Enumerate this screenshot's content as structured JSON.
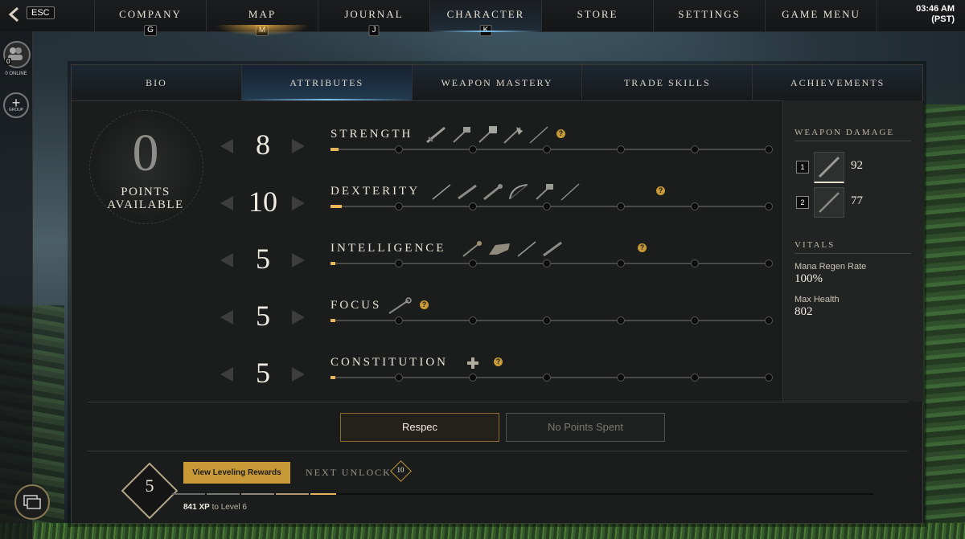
{
  "topbar": {
    "esc_label": "ESC",
    "nav": [
      {
        "label": "COMPANY",
        "key": "G"
      },
      {
        "label": "MAP",
        "key": "M"
      },
      {
        "label": "JOURNAL",
        "key": "J"
      },
      {
        "label": "CHARACTER",
        "key": "K"
      },
      {
        "label": "STORE",
        "key": ""
      },
      {
        "label": "SETTINGS",
        "key": ""
      },
      {
        "label": "GAME MENU",
        "key": ""
      }
    ],
    "time": "03:46 AM",
    "timezone": "(PST)"
  },
  "rail": {
    "online_count": "0",
    "online_label": "0 ONLINE",
    "group_label": "GROUP"
  },
  "tabs": [
    "BIO",
    "ATTRIBUTES",
    "WEAPON MASTERY",
    "TRADE SKILLS",
    "ACHIEVEMENTS"
  ],
  "points": {
    "value": "0",
    "label_line1": "POINTS",
    "label_line2": "AVAILABLE"
  },
  "attributes": [
    {
      "name": "STRENGTH",
      "value": "8",
      "weapon_icons": [
        "sword-icon",
        "hatchet-icon",
        "war-hammer-icon",
        "great-axe-icon",
        "spear-icon"
      ]
    },
    {
      "name": "DEXTERITY",
      "value": "10",
      "weapon_icons": [
        "rapier-icon",
        "musket-icon",
        "blunderbuss-icon",
        "bow-icon",
        "hatchet-icon",
        "spear-icon"
      ]
    },
    {
      "name": "INTELLIGENCE",
      "value": "5",
      "weapon_icons": [
        "fire-staff-icon",
        "void-gauntlet-icon",
        "rapier-icon",
        "musket-icon"
      ]
    },
    {
      "name": "FOCUS",
      "value": "5",
      "weapon_icons": [
        "life-staff-icon"
      ]
    },
    {
      "name": "CONSTITUTION",
      "value": "5",
      "weapon_icons": [
        "plus-icon"
      ]
    }
  ],
  "weapon_damage": {
    "title": "WEAPON DAMAGE",
    "slots": [
      {
        "key": "1",
        "value": "92"
      },
      {
        "key": "2",
        "value": "77"
      }
    ]
  },
  "vitals": {
    "title": "VITALS",
    "items": [
      {
        "label": "Mana Regen Rate",
        "value": "100%"
      },
      {
        "label": "Max Health",
        "value": "802"
      }
    ]
  },
  "buttons": {
    "respec": "Respec",
    "no_points": "No Points Spent"
  },
  "leveling": {
    "level": "5",
    "rewards_button": "View Leveling Rewards",
    "next_unlock_label": "NEXT UNLOCK",
    "next_unlock_level": "10",
    "xp_amount": "841 XP",
    "xp_suffix": "to Level 6"
  },
  "colors": {
    "accent_gold": "#c79a37",
    "active_blue": "#7cc4ef",
    "progress_fill": "#e9b55a"
  }
}
